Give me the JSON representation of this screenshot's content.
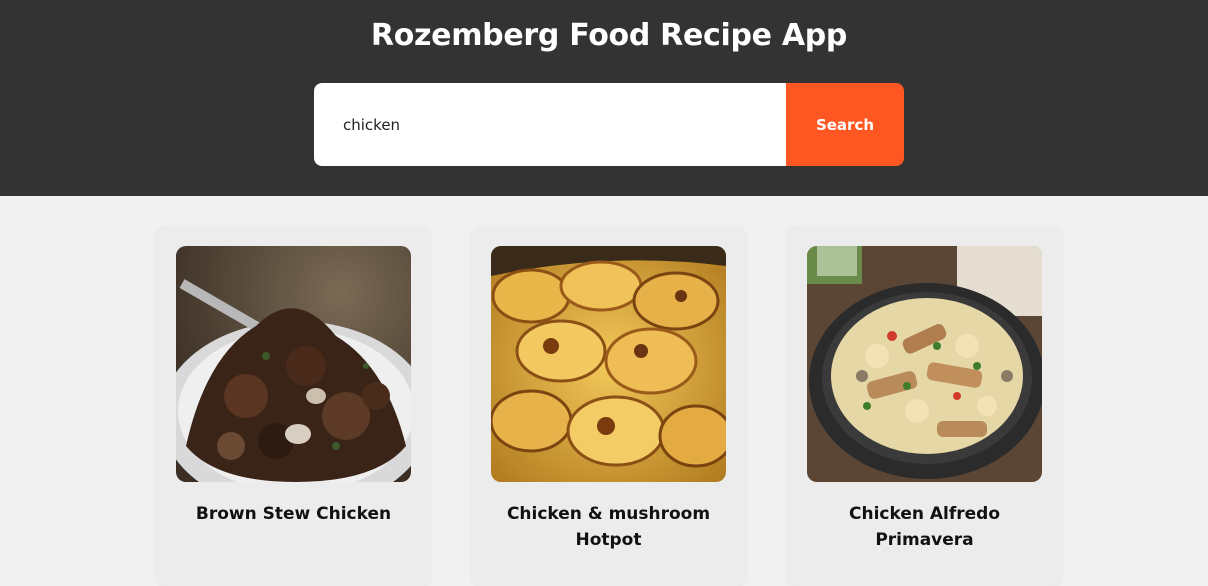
{
  "header": {
    "title": "Rozemberg Food Recipe App"
  },
  "search": {
    "value": "chicken",
    "button_label": "Search"
  },
  "colors": {
    "header_bg": "#333333",
    "accent": "#ff5722",
    "page_bg": "#f1f1f1"
  },
  "recipes": [
    {
      "title": "Brown Stew Chicken"
    },
    {
      "title": "Chicken & mushroom Hotpot"
    },
    {
      "title": "Chicken Alfredo Primavera"
    }
  ]
}
